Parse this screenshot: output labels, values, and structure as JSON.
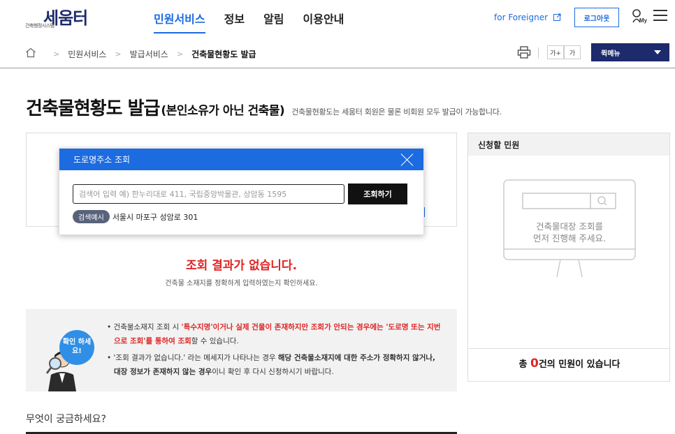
{
  "header": {
    "logo_text": "세움터",
    "logo_sub": "건축행정시스템",
    "nav": [
      "민원서비스",
      "정보",
      "알림",
      "이용안내"
    ],
    "foreigner_label": "for Foreigner",
    "logout_label": "로그아웃",
    "my_label": "My"
  },
  "breadcrumb": {
    "items": [
      "민원서비스",
      "발급서비스",
      "건축물현황도 발급"
    ]
  },
  "toolbar": {
    "font_up": "가+",
    "font_down": "가",
    "quick_menu": "퀵메뉴"
  },
  "page": {
    "title": "건축물현황도 발급",
    "title_paren": "(본인소유가 아닌 건축물)",
    "description": "건축물현황도는 세움터 회원은 물론 비회원 모두 발급이 가능합니다."
  },
  "popup": {
    "title": "도로명주소 조회",
    "input_placeholder": "검색어 입력 예) 한누리대로 411, 국립중앙박물관, 상암동 1595",
    "search_button": "조회하기",
    "example_badge": "검색예시",
    "example_text": "서울시 마포구 성암로 301"
  },
  "result": {
    "title": "조회 결과가 없습니다.",
    "subtitle": "건축물 소재지를 정확하게 입력하였는지 확인하세요."
  },
  "info": {
    "badge": "확인 하세요!",
    "line1_a": "건축물소재지 조회 시 ",
    "line1_b": "'특수지명'이거나 실제 건물이 존재하지만 조회가 안되는 경우에는 '도로명 또는 지번으로 조회'를 통하여 조회",
    "line1_c": "할 수 있습니다.",
    "line2_a": "'조회 결과가 없습니다.' 라는 메세지가 나타나는 경우 ",
    "line2_b": "해당 건축물소재지에 대한 주소가 정확하지 않거나, 대장 정보가 존재하지 않는 경우",
    "line2_c": "이니 확인 후 다시 신청하시기 바랍니다."
  },
  "faq": {
    "title": "무엇이 궁금하세요?"
  },
  "right_panel": {
    "title": "신청할 민원",
    "illus_line1": "건축물대장 조회를",
    "illus_line2": "먼저 진행해 주세요.",
    "count_prefix": "총 ",
    "count": "0",
    "count_suffix": "건의 민원이 있습니다"
  }
}
